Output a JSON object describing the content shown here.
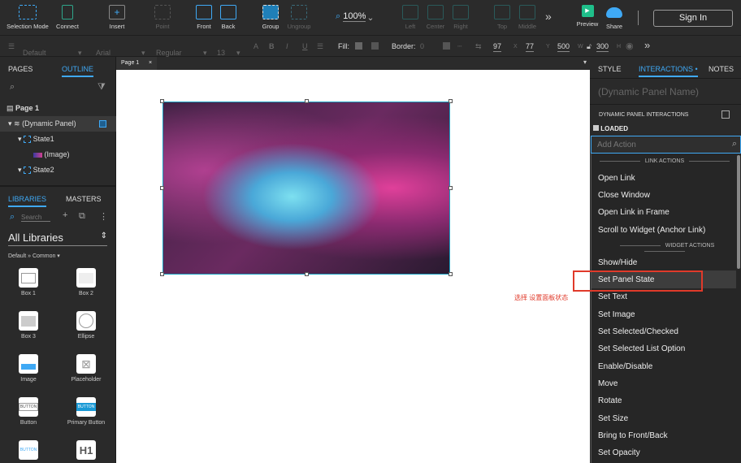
{
  "toolbar": {
    "items": [
      {
        "label": "Selection Mode",
        "icon": "selection-mode-icon"
      },
      {
        "label": "Connect",
        "icon": "connect-icon"
      },
      {
        "label": "Insert",
        "icon": "insert-icon"
      },
      {
        "label": "Point",
        "icon": "point-icon"
      },
      {
        "label": "Front",
        "icon": "bring-front-icon"
      },
      {
        "label": "Back",
        "icon": "send-back-icon"
      },
      {
        "label": "Group",
        "icon": "group-icon"
      },
      {
        "label": "Ungroup",
        "icon": "ungroup-icon"
      },
      {
        "label": "Left",
        "icon": "align-left-icon"
      },
      {
        "label": "Center",
        "icon": "align-center-icon"
      },
      {
        "label": "Right",
        "icon": "align-right-icon"
      },
      {
        "label": "Top",
        "icon": "align-top-icon"
      },
      {
        "label": "Middle",
        "icon": "align-middle-icon"
      },
      {
        "label": "Preview",
        "icon": "preview-icon"
      },
      {
        "label": "Share",
        "icon": "cloud-icon"
      }
    ],
    "zoom": "100%",
    "sign_in": "Sign In"
  },
  "format": {
    "style": "Default",
    "font": "Arial",
    "weight": "Regular",
    "size": "13",
    "fill": "Fill:",
    "border": "Border:",
    "border_value": "0",
    "x": "97",
    "x_label": "X",
    "y": "77",
    "y_label": "Y",
    "w": "500",
    "w_label": "W",
    "h": "300",
    "h_label": "H"
  },
  "left": {
    "tabs": [
      "PAGES",
      "OUTLINE"
    ],
    "tree": [
      "Page 1",
      "(Dynamic Panel)",
      "State1",
      "(Image)",
      "State2"
    ],
    "lib_tabs": [
      "LIBRARIES",
      "MASTERS"
    ],
    "search_placeholder": "Search",
    "library": "All Libraries",
    "breadcrumb": "Default » Common ▾",
    "widgets": [
      "Box 1",
      "Box 2",
      "Box 3",
      "Ellipse",
      "Image",
      "Placeholder",
      "Button",
      "Primary Button",
      "BUTTON",
      "H1"
    ]
  },
  "canvas": {
    "tab": "Page 1",
    "annotation": "选择 设置面板状态",
    "highlight_color": "#e03a2a"
  },
  "right": {
    "tabs": [
      "STYLE",
      "INTERACTIONS",
      "NOTES"
    ],
    "name_placeholder": "(Dynamic Panel Name)",
    "section": "DYNAMIC PANEL INTERACTIONS",
    "event": "LOADED",
    "add_action_placeholder": "Add Action",
    "link_header": "LINK ACTIONS",
    "link_actions": [
      "Open Link",
      "Close Window",
      "Open Link in Frame",
      "Scroll to Widget (Anchor Link)"
    ],
    "widget_header": "WIDGET ACTIONS",
    "widget_actions": [
      "Show/Hide",
      "Set Panel State",
      "Set Text",
      "Set Image",
      "Set Selected/Checked",
      "Set Selected List Option",
      "Enable/Disable",
      "Move",
      "Rotate",
      "Set Size",
      "Bring to Front/Back",
      "Set Opacity"
    ]
  }
}
